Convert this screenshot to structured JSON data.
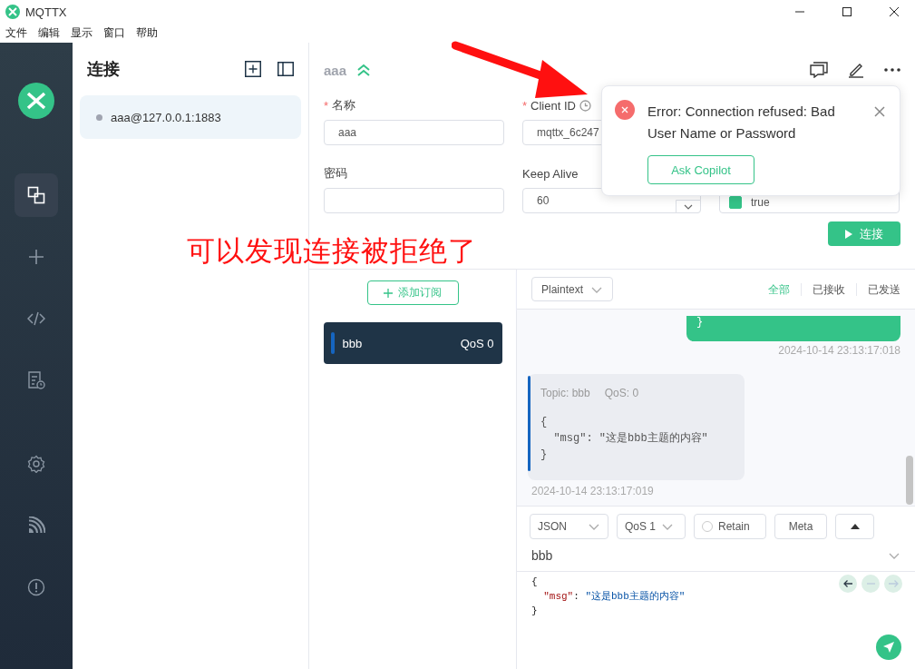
{
  "window": {
    "title": "MQTTX"
  },
  "menu": [
    "文件",
    "编辑",
    "显示",
    "窗口",
    "帮助"
  ],
  "nav": [
    {
      "kind": "connections",
      "selected": true
    },
    {
      "kind": "new",
      "selected": false
    },
    {
      "kind": "script",
      "selected": false
    },
    {
      "kind": "log",
      "selected": false
    },
    {
      "kind": "settings",
      "selected": false
    },
    {
      "kind": "feed",
      "selected": false
    },
    {
      "kind": "about",
      "selected": false
    }
  ],
  "connections_panel": {
    "title": "连接",
    "items": [
      {
        "label": "aaa@127.0.0.1:1883",
        "connected": false,
        "selected": true
      }
    ]
  },
  "connection": {
    "name": "aaa",
    "fields": [
      {
        "kind": "text",
        "marker": "*",
        "label": "名称",
        "value": "aaa"
      },
      {
        "kind": "id",
        "marker": "*",
        "label": "Client ID",
        "value": "mqttx_6c247"
      },
      {
        "kind": "hidden"
      },
      {
        "kind": "text",
        "label": "密码"
      },
      {
        "kind": "number",
        "label": "Keep Alive",
        "value": "60"
      },
      {
        "kind": "check",
        "value": "true",
        "checked": true
      }
    ],
    "connect_button": "连接"
  },
  "topics": {
    "add_button": "添加订阅",
    "items": [
      {
        "topic": "bbb",
        "qos": "QoS 0",
        "color": "#1565c0"
      }
    ]
  },
  "messages": {
    "format": "Plaintext",
    "filters": [
      {
        "label": "全部",
        "selected": true
      },
      {
        "label": "已接收",
        "selected": false
      },
      {
        "label": "已发送",
        "selected": false
      }
    ],
    "items": [
      {
        "kind": "sent",
        "lines": [
          "}"
        ],
        "time": "2024-10-14 23:13:17:018"
      },
      {
        "kind": "received",
        "topic": "Topic: bbb",
        "qos": "QoS: 0",
        "color": "#1565c0",
        "lines": [
          "{",
          "  \"msg\": \"这是bbb主题的内容\"",
          "}"
        ],
        "time": "2024-10-14 23:13:17:019"
      }
    ]
  },
  "publish": {
    "format": "JSON",
    "qos": "QoS 1",
    "retain": {
      "label": "Retain",
      "checked": false
    },
    "meta": "Meta",
    "topic": "bbb",
    "payload": [
      "{",
      "  \"msg\": \"这是bbb主题的内容\"",
      "}"
    ]
  },
  "toast": {
    "message": "Error: Connection refused: Bad User Name or Password",
    "action": "Ask Copilot"
  },
  "annotation": {
    "text": "可以发现连接被拒绝了"
  }
}
